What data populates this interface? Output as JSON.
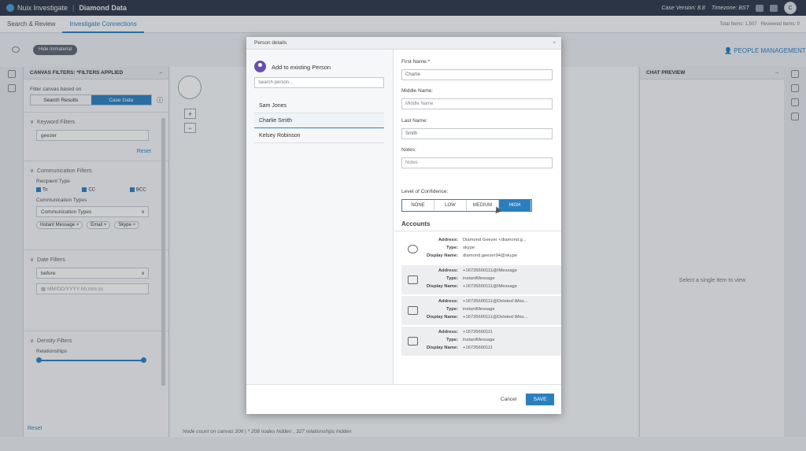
{
  "topbar": {
    "brand": "Nuix Investigate",
    "separator": "|",
    "project": "Diamond Data",
    "case_version": "Case Version: 8.8",
    "timezone": "Timezone: BST",
    "avatar_letter": "C"
  },
  "nav": {
    "tabs": [
      "Search & Review",
      "Investigate Connections"
    ],
    "total_items": "Total Items: 1,507",
    "reviewed_items": "Reviewed Items: 0"
  },
  "toolbar": {
    "hide_immaterial": "Hide Immaterial",
    "people_management": "PEOPLE MANAGEMENT"
  },
  "filters": {
    "title": "CANVAS FILTERS: *FILTERS APPLIED",
    "filter_based_on": "Filter canvas based on",
    "search_results": "Search Results",
    "case_data": "Case Data",
    "keyword_title": "Keyword Filters",
    "keyword_value": "geezer",
    "reset": "Reset",
    "communication_title": "Communication Filters",
    "recipient_type": "Recipient Type",
    "to": "To",
    "cc": "CC",
    "bcc": "BCC",
    "communication_types": "Communication Types",
    "communication_types_placeholder": "Communication Types",
    "chips": [
      "Instant Message",
      "Email",
      "Skype"
    ],
    "date_title": "Date Filters",
    "date_mode": "before",
    "date_placeholder": "MM/DD/YYYY hh:mm:ss",
    "density_title": "Density Filters",
    "relationships": "Relationships",
    "bottom_reset": "Reset"
  },
  "canvas": {
    "zoom_in": "+",
    "zoom_out": "−",
    "node_count": "Node count on canvas 206 | * 208 nodes hidden , 327 relationships hidden"
  },
  "chat": {
    "title": "CHAT PREVIEW",
    "empty": "Select a single item to view"
  },
  "modal": {
    "title": "Person details",
    "close": "×",
    "add_existing": "Add to existing Person",
    "search_placeholder": "Search person...",
    "persons": [
      "Sam Jones",
      "Charlie Smith",
      "Kelsey Robinson"
    ],
    "first_name_label": "First Name:*",
    "first_name_value": "Charlie",
    "middle_name_label": "Middle Name:",
    "middle_name_placeholder": "Middle Name",
    "last_name_label": "Last Name:",
    "last_name_value": "Smith",
    "notes_label": "Notes:",
    "notes_placeholder": "Notes",
    "confidence_label": "Level of Confidence:",
    "confidence_levels": [
      "NONE",
      "LOW",
      "MEDIUM",
      "HIGH"
    ],
    "confidence_selected": "HIGH",
    "accounts_title": "Accounts",
    "field_labels": {
      "address": "Address:",
      "type": "Type:",
      "display_name": "Display Name:"
    },
    "accounts": [
      {
        "icon": "skype-icon",
        "address": "Diamond Geezer <diamond.g...",
        "type": "skype",
        "display_name": "diamond.geezer94@skype"
      },
      {
        "icon": "chat-bubbles-icon",
        "address": "+16735600111@IMessage",
        "type": "instantMessage",
        "display_name": "+16735600111@IMessage"
      },
      {
        "icon": "chat-bubbles-icon",
        "address": "+16735600111@Deleted iMes...",
        "type": "instantMessage",
        "display_name": "+16735600111@Deleted iMes..."
      },
      {
        "icon": "chat-bubbles-icon",
        "address": "+16735600111",
        "type": "instantMessage",
        "display_name": "+16735600111"
      }
    ],
    "cancel": "Cancel",
    "save": "SAVE"
  },
  "colors": {
    "accent": "#2a7fbf",
    "topbar": "#2d3748",
    "person_icon": "#6b4fa8"
  }
}
